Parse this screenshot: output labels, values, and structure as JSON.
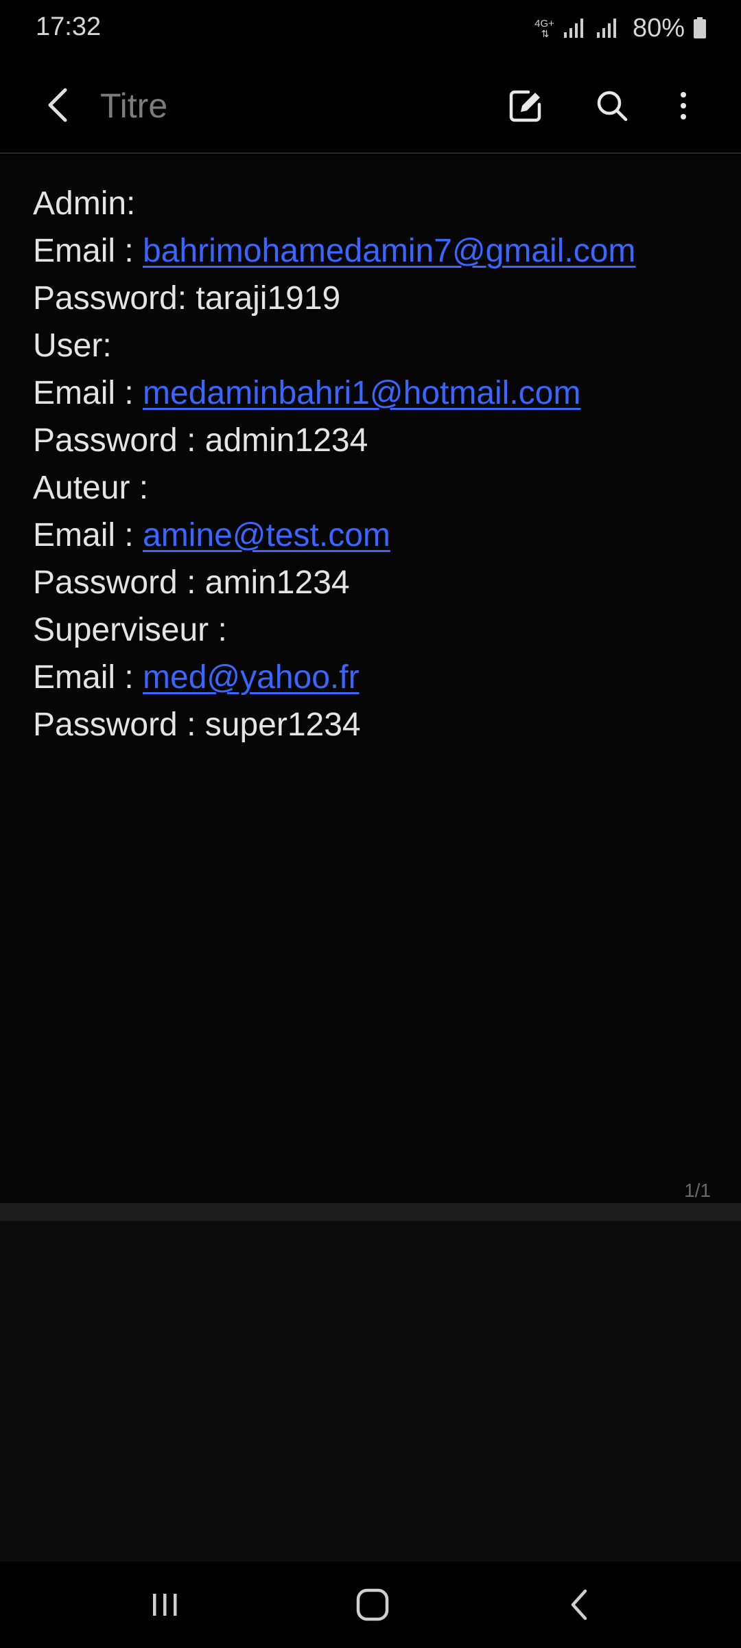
{
  "status_bar": {
    "time": "17:32",
    "network": "4G+",
    "battery": "80%",
    "icons": [
      "data-arrows-icon",
      "signal-icon",
      "signal-icon",
      "battery-icon"
    ]
  },
  "toolbar": {
    "title_placeholder": "Titre",
    "icons": [
      "back-arrow-icon",
      "edit-icon",
      "search-icon",
      "more-vert-icon"
    ]
  },
  "note": {
    "lines": [
      {
        "text": "Admin:"
      },
      {
        "prefix": "Email : ",
        "link": "bahrimohamedamin7@gmail.com"
      },
      {
        "text": "Password: taraji1919"
      },
      {
        "text": "User:"
      },
      {
        "prefix": "Email : ",
        "link": "medaminbahri1@hotmail.com"
      },
      {
        "text": "Password : admin1234"
      },
      {
        "text": "Auteur :"
      },
      {
        "prefix": "Email : ",
        "link": "amine@test.com"
      },
      {
        "text": "Password : amin1234"
      },
      {
        "text": "Superviseur :"
      },
      {
        "prefix": "Email : ",
        "link": "med@yahoo.fr"
      },
      {
        "text": "Password : super1234"
      }
    ],
    "page_indicator": "1/1",
    "link_color": "#3a66ff"
  },
  "nav_bar": {
    "icons": [
      "recents-icon",
      "home-icon",
      "back-icon"
    ]
  }
}
